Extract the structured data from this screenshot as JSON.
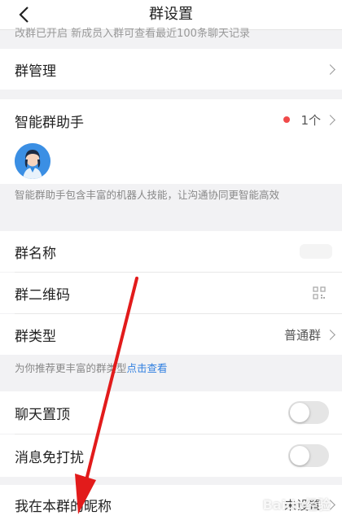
{
  "header": {
    "title": "群设置"
  },
  "cut_note": "改群已开启 新成员入群可查看最近100条聊天记录",
  "group_manage": {
    "label": "群管理"
  },
  "assistant": {
    "label": "智能群助手",
    "count": "1个",
    "hint": "智能群助手包含丰富的机器人技能，让沟通协同更智能高效"
  },
  "group_name": {
    "label": "群名称"
  },
  "qr_code": {
    "label": "群二维码"
  },
  "group_type": {
    "label": "群类型",
    "value": "普通群"
  },
  "recommend": {
    "text": "为你推荐更丰富的群类型",
    "link": "点击查看"
  },
  "pin_chat": {
    "label": "聊天置顶"
  },
  "mute": {
    "label": "消息免打扰"
  },
  "nickname": {
    "label": "我在本群的昵称",
    "value": "未设置"
  },
  "watermark": "Baidu经验",
  "colors": {
    "accent": "#2f7fe0",
    "arrow": "#e21b1b",
    "badge": "#f04a4a"
  }
}
